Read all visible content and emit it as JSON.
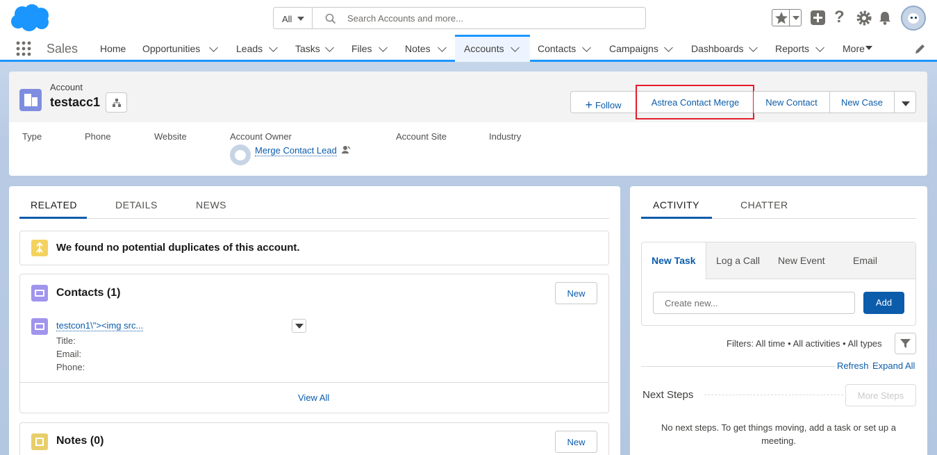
{
  "search": {
    "scope": "All",
    "placeholder": "Search Accounts and more..."
  },
  "app": {
    "name": "Sales"
  },
  "nav": {
    "home": "Home",
    "opportunities": "Opportunities",
    "leads": "Leads",
    "tasks": "Tasks",
    "files": "Files",
    "notes": "Notes",
    "accounts": "Accounts",
    "contacts": "Contacts",
    "campaigns": "Campaigns",
    "dashboards": "Dashboards",
    "reports": "Reports",
    "more": "More"
  },
  "record": {
    "object": "Account",
    "name": "testacc1"
  },
  "actions": {
    "follow": "Follow",
    "merge": "Astrea Contact Merge",
    "new_contact": "New Contact",
    "new_case": "New Case"
  },
  "fields": {
    "type": "Type",
    "phone": "Phone",
    "website": "Website",
    "owner": "Account Owner",
    "owner_value": "Merge Contact Lead",
    "site": "Account Site",
    "industry": "Industry"
  },
  "left_tabs": {
    "related": "RELATED",
    "details": "DETAILS",
    "news": "NEWS"
  },
  "duplicates": {
    "text": "We found no potential duplicates of this account."
  },
  "contacts": {
    "title": "Contacts (1)",
    "new": "New",
    "row_name": "testcon1\\\"><img src...",
    "title_label": "Title:",
    "email_label": "Email:",
    "phone_label": "Phone:",
    "view_all": "View All"
  },
  "notes": {
    "title": "Notes (0)",
    "new": "New"
  },
  "right_tabs": {
    "activity": "ACTIVITY",
    "chatter": "CHATTER"
  },
  "publisher": {
    "new_task": "New Task",
    "log_call": "Log a Call",
    "new_event": "New Event",
    "email": "Email",
    "placeholder": "Create new...",
    "add": "Add"
  },
  "filters": {
    "text": "Filters: All time • All activities • All types",
    "refresh": "Refresh",
    "expand_all": "Expand All"
  },
  "next_steps": {
    "title": "Next Steps",
    "more_steps": "More Steps",
    "empty": "No next steps. To get things moving, add a task or set up a meeting."
  },
  "colors": {
    "brand": "#1b96ff",
    "link": "#0b5cab",
    "highlight": "#e41c2c",
    "account_icon": "#7f8de1",
    "contact_icon": "#a094ed",
    "duplicate_icon": "#f4d25f",
    "notes_icon": "#e8ce6a"
  }
}
